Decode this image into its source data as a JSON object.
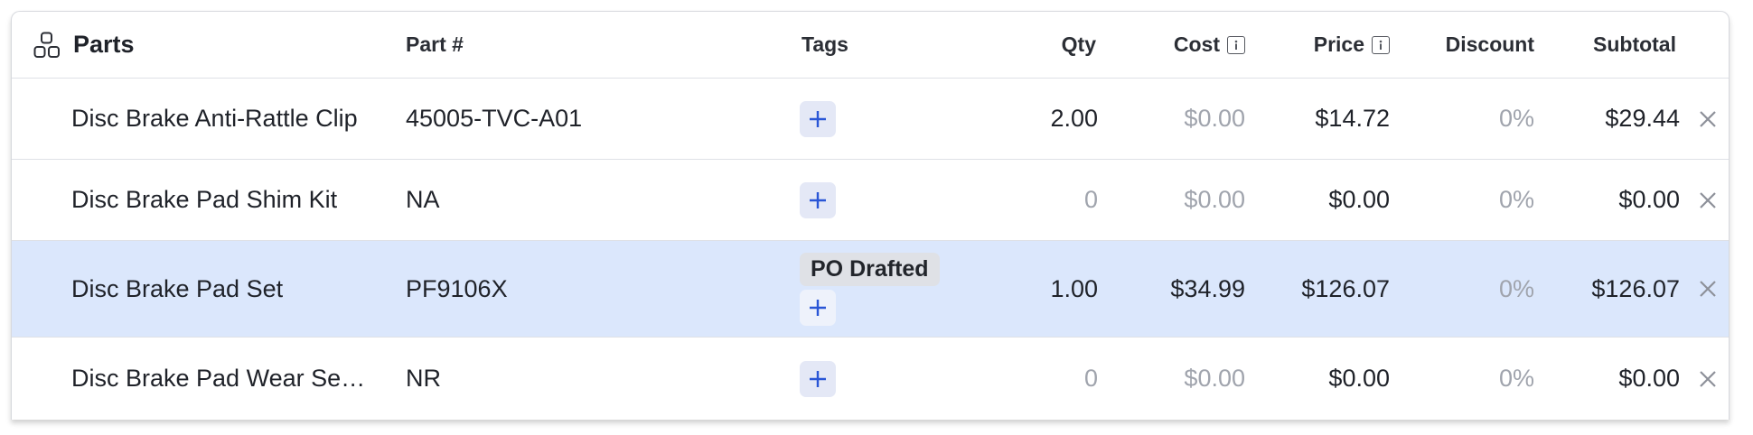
{
  "header": {
    "title": "Parts",
    "columns": {
      "part_no": "Part #",
      "tags": "Tags",
      "qty": "Qty",
      "cost": "Cost",
      "price": "Price",
      "discount": "Discount",
      "subtotal": "Subtotal"
    }
  },
  "rows": [
    {
      "name": "Disc Brake Anti-Rattle Clip",
      "part_no": "45005-TVC-A01",
      "tags": [],
      "qty": "2.00",
      "cost": "$0.00",
      "price": "$14.72",
      "discount": "0%",
      "subtotal": "$29.44"
    },
    {
      "name": "Disc Brake Pad Shim Kit",
      "part_no": "NA",
      "tags": [],
      "qty": "0",
      "cost": "$0.00",
      "price": "$0.00",
      "discount": "0%",
      "subtotal": "$0.00"
    },
    {
      "name": "Disc Brake Pad Set",
      "part_no": "PF9106X",
      "tags": [
        "PO Drafted"
      ],
      "qty": "1.00",
      "cost": "$34.99",
      "price": "$126.07",
      "discount": "0%",
      "subtotal": "$126.07",
      "selected": true
    },
    {
      "name": "Disc Brake Pad Wear Sen…",
      "part_no": "NR",
      "tags": [],
      "qty": "0",
      "cost": "$0.00",
      "price": "$0.00",
      "discount": "0%",
      "subtotal": "$0.00"
    }
  ],
  "icons": {
    "header": "parts-icon",
    "info": "info-icon",
    "add_tag": "plus-icon",
    "remove": "close-icon"
  },
  "colors": {
    "selected_row": "#dbe7fc",
    "accent": "#2a56d6",
    "muted_text": "#a0a4ad"
  }
}
